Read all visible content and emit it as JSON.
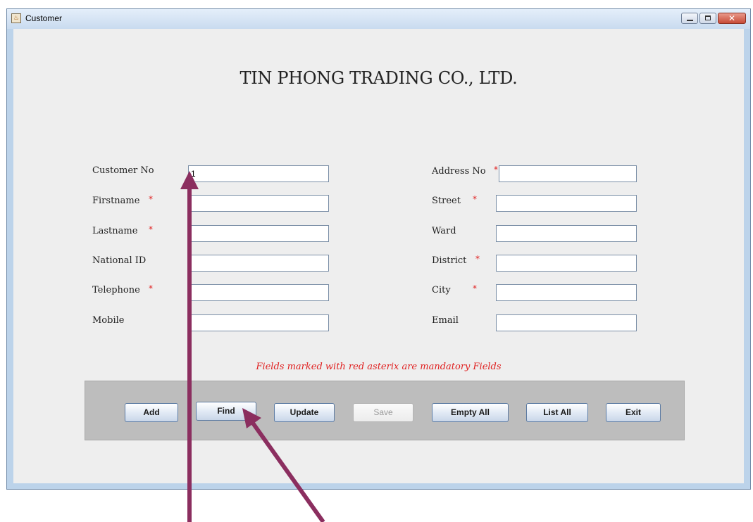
{
  "window": {
    "title": "Customer"
  },
  "heading": "TIN PHONG TRADING CO., LTD.",
  "left_fields": [
    {
      "label": "Customer No",
      "required": false,
      "value": "1"
    },
    {
      "label": "Firstname",
      "required": true,
      "value": ""
    },
    {
      "label": "Lastname",
      "required": true,
      "value": ""
    },
    {
      "label": "National ID",
      "required": false,
      "value": ""
    },
    {
      "label": "Telephone",
      "required": true,
      "value": ""
    },
    {
      "label": "Mobile",
      "required": false,
      "value": ""
    }
  ],
  "right_fields": [
    {
      "label": "Address No",
      "required": true,
      "value": ""
    },
    {
      "label": "Street",
      "required": true,
      "value": ""
    },
    {
      "label": "Ward",
      "required": false,
      "value": ""
    },
    {
      "label": "District",
      "required": true,
      "value": ""
    },
    {
      "label": "City",
      "required": true,
      "value": ""
    },
    {
      "label": "Email",
      "required": false,
      "value": ""
    }
  ],
  "asterisk": "*",
  "notice": "Fields marked with red asterix are mandatory Fields",
  "buttons": {
    "add": "Add",
    "find": "Find",
    "update": "Update",
    "save": "Save",
    "empty_all": "Empty All",
    "list_all": "List All",
    "exit": "Exit"
  },
  "annotation_arrow_color": "#8b2e5f",
  "required_color": "#e02020"
}
